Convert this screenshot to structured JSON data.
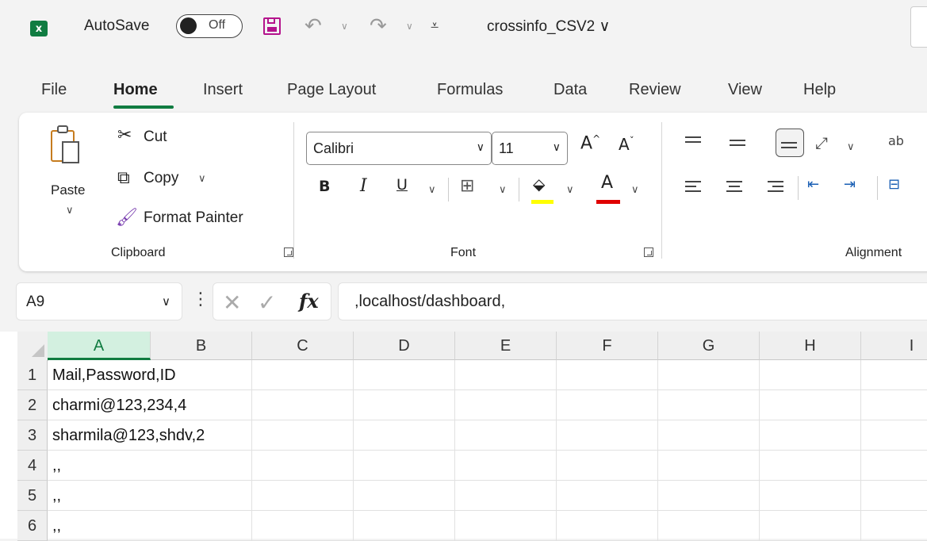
{
  "titlebar": {
    "app_icon": "excel-icon",
    "app_icon_text": "x",
    "autosave_label": "AutoSave",
    "autosave_state": "Off",
    "document_name": "crossinfo_CSV2 ∨"
  },
  "tabs": [
    "File",
    "Home",
    "Insert",
    "Page Layout",
    "Formulas",
    "Data",
    "Review",
    "View",
    "Help"
  ],
  "active_tab": "Home",
  "clipboard": {
    "paste": "Paste",
    "cut": "Cut",
    "copy": "Copy",
    "format_painter": "Format Painter",
    "group_label": "Clipboard"
  },
  "font": {
    "font_name": "Calibri",
    "font_size": "11",
    "bold": "B",
    "italic": "I",
    "underline": "U",
    "group_label": "Font",
    "fill_color": "#ffff00",
    "font_color": "#e00000"
  },
  "alignment": {
    "group_label": "Alignment"
  },
  "formula_bar": {
    "name_box": "A9",
    "fx": "fx",
    "formula": ",localhost/dashboard,"
  },
  "grid": {
    "columns": [
      "A",
      "B",
      "C",
      "D",
      "E",
      "F",
      "G",
      "H",
      "I"
    ],
    "selected_column": "A",
    "rows": [
      {
        "num": "1",
        "a": "Mail,Password,ID"
      },
      {
        "num": "2",
        "a": "charmi@123,234,4"
      },
      {
        "num": "3",
        "a": "sharmila@123,shdv,2"
      },
      {
        "num": "4",
        "a": ",,"
      },
      {
        "num": "5",
        "a": ",,"
      },
      {
        "num": "6",
        "a": ",,"
      }
    ]
  },
  "colors": {
    "accent": "#107c41",
    "save_icon": "#b4138c"
  }
}
